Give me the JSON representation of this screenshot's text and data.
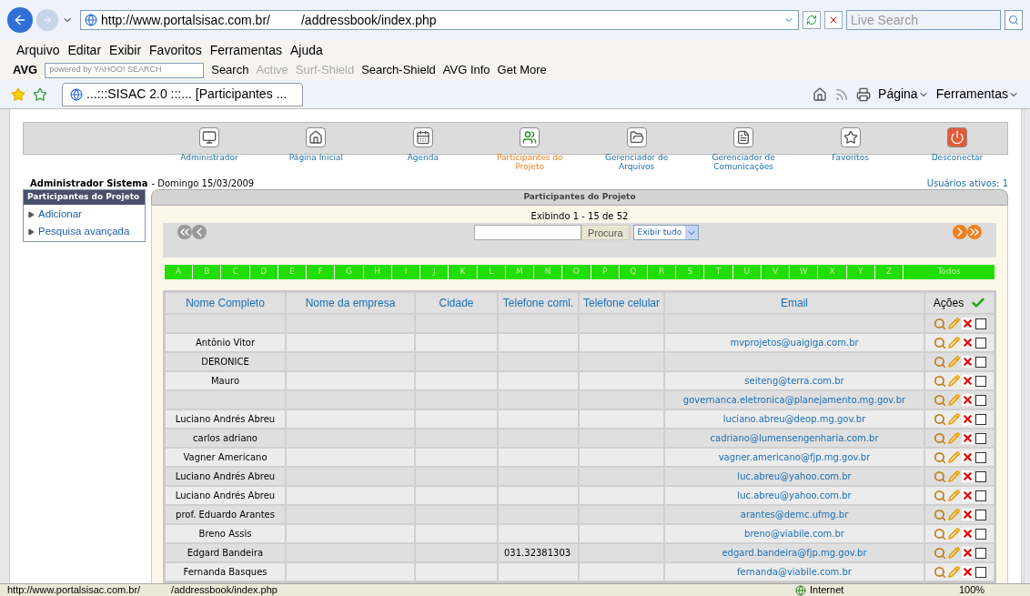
{
  "browser": {
    "address_parts": [
      "http://www.portalsisac.com.br/",
      "/addressbook/index.php"
    ],
    "search_placeholder": "Live Search",
    "menu": [
      "Arquivo",
      "Editar",
      "Exibir",
      "Favoritos",
      "Ferramentas",
      "Ajuda"
    ],
    "toolbar": {
      "brand": "AVG",
      "search_placeholder": "powered by YAHOO! SEARCH",
      "items": [
        {
          "label": "Search",
          "disabled": false
        },
        {
          "label": "Active",
          "disabled": true
        },
        {
          "label": "Surf-Shield",
          "disabled": true
        },
        {
          "label": "Search-Shield",
          "disabled": false
        },
        {
          "label": "AVG Info",
          "disabled": false
        },
        {
          "label": "Get More",
          "disabled": false
        }
      ]
    },
    "tab": "...:::SISAC 2.0 :::... [Participantes ...",
    "commands": [
      "Página",
      "Ferramentas"
    ]
  },
  "nav": [
    {
      "label": "Administrador",
      "kind": "admin",
      "selected": false
    },
    {
      "label": "Página Inicial",
      "kind": "home",
      "selected": false
    },
    {
      "label": "Agenda",
      "kind": "calendar",
      "selected": false
    },
    {
      "label": "Participantes do Projeto",
      "kind": "people",
      "selected": true
    },
    {
      "label": "Gerenciador de Arquivos",
      "kind": "files",
      "selected": false
    },
    {
      "label": "Gerenciador de Comunicações",
      "kind": "docs",
      "selected": false
    },
    {
      "label": "Favoritos",
      "kind": "star",
      "selected": false
    },
    {
      "label": "Desconectar",
      "kind": "power",
      "selected": false
    }
  ],
  "user": {
    "name": "Administrador Sistema",
    "date": "- Domingo 15/03/2009",
    "active_users": "Usuários ativos: 1"
  },
  "sidebar": {
    "title": "Participantes do Projeto",
    "items": [
      "Adicionar",
      "Pesquisa avançada"
    ]
  },
  "panel": {
    "title": "Participantes do Projeto",
    "showing": "Exibindo 1 - 15 de 52",
    "search_button": "Procura",
    "filter": "Exibir tudo",
    "letters": [
      "A",
      "B",
      "C",
      "D",
      "E",
      "F",
      "G",
      "H",
      "I",
      "J",
      "K",
      "L",
      "M",
      "N",
      "O",
      "P",
      "Q",
      "R",
      "S",
      "T",
      "U",
      "V",
      "W",
      "X",
      "Y",
      "Z",
      "Todos"
    ]
  },
  "table": {
    "columns": [
      "Nome Completo",
      "Nome da empresa",
      "Cidade",
      "Telefone coml.",
      "Telefone celular",
      "Email",
      "Ações"
    ],
    "rows": [
      {
        "name": "",
        "phone": "",
        "email": "",
        "checked": false
      },
      {
        "name": "Antônio Vitor",
        "phone": "",
        "email": "mvprojetos@uaigiga.com.br",
        "checked": false
      },
      {
        "name": "DERONICE",
        "phone": "",
        "email": "",
        "checked": false
      },
      {
        "name": "Mauro",
        "phone": "",
        "email": "seiteng@terra.com.br",
        "checked": false
      },
      {
        "name": "",
        "phone": "",
        "email": "governanca.eletronica@planejamento.mg.gov.br",
        "checked": false
      },
      {
        "name": "Luciano Andrés Abreu",
        "phone": "",
        "email": "luciano.abreu@deop.mg.gov.br",
        "checked": false
      },
      {
        "name": "carlos adriano",
        "phone": "",
        "email": "cadriano@lumensengenharia.com.br",
        "checked": false
      },
      {
        "name": "Vagner Americano",
        "phone": "",
        "email": "vagner.americano@fjp.mg.gov.br",
        "checked": false
      },
      {
        "name": "Luciano Andrés Abreu",
        "phone": "",
        "email": "luc.abreu@yahoo.com.br",
        "checked": false
      },
      {
        "name": "Luciano Andrés Abreu",
        "phone": "",
        "email": "luc.abreu@yahoo.com.br",
        "checked": false
      },
      {
        "name": "prof. Eduardo Arantes",
        "phone": "",
        "email": "arantes@demc.ufmg.br",
        "checked": false
      },
      {
        "name": "Breno Assis",
        "phone": "",
        "email": "breno@viabile.com.br",
        "checked": false
      },
      {
        "name": "Edgard Bandeira",
        "phone": "031.32381303",
        "email": "edgard.bandeira@fjp.mg.gov.br",
        "checked": false
      },
      {
        "name": "Fernanda Basques",
        "phone": "",
        "email": "fernanda@viabile.com.br",
        "checked": false
      }
    ]
  },
  "status_bar": {
    "url_parts": [
      "http://www.portalsisac.com.br/",
      "/addressbook/index.php"
    ],
    "zone": "Internet",
    "zoom": "100%"
  }
}
